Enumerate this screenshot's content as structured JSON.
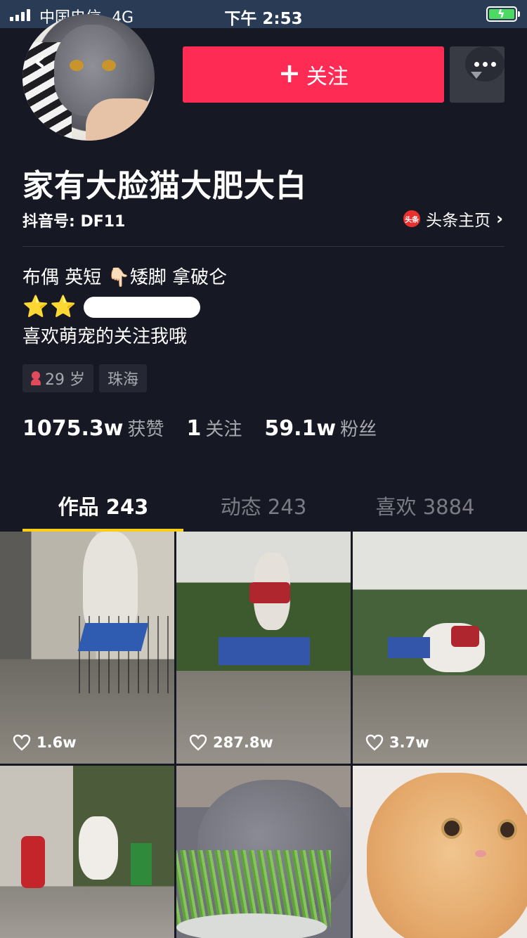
{
  "status_bar": {
    "carrier": "中国电信",
    "network": "4G",
    "time": "下午 2:53"
  },
  "header": {
    "back_icon": "chevron-left-icon",
    "follow_label": "关注",
    "more_icon": "more-dots-icon"
  },
  "profile": {
    "name": "家有大脸猫大肥大白",
    "douyin_id": "抖音号: DF11",
    "toutiao_label": "头条主页",
    "toutiao_icon_text": "头条"
  },
  "bio": {
    "line1": "布偶 英短 👇🏻矮脚 拿破仑",
    "line2_stars": "⭐⭐",
    "line3": "喜欢萌宠的关注我哦"
  },
  "tags": {
    "age": "29 岁",
    "location": "珠海"
  },
  "stats": {
    "likes_num": "1075.3w",
    "likes_label": "获赞",
    "following_num": "1",
    "following_label": "关注",
    "fans_num": "59.1w",
    "fans_label": "粉丝"
  },
  "tabs": {
    "works": "作品 243",
    "dynamic": "动态 243",
    "likes": "喜欢 3884"
  },
  "videos": [
    {
      "likes": "1.6w"
    },
    {
      "likes": "287.8w"
    },
    {
      "likes": "3.7w"
    },
    {
      "likes": ""
    },
    {
      "likes": ""
    },
    {
      "likes": ""
    }
  ],
  "colors": {
    "background": "#161823",
    "follow_red": "#fe2c55",
    "tab_underline": "#face15"
  }
}
